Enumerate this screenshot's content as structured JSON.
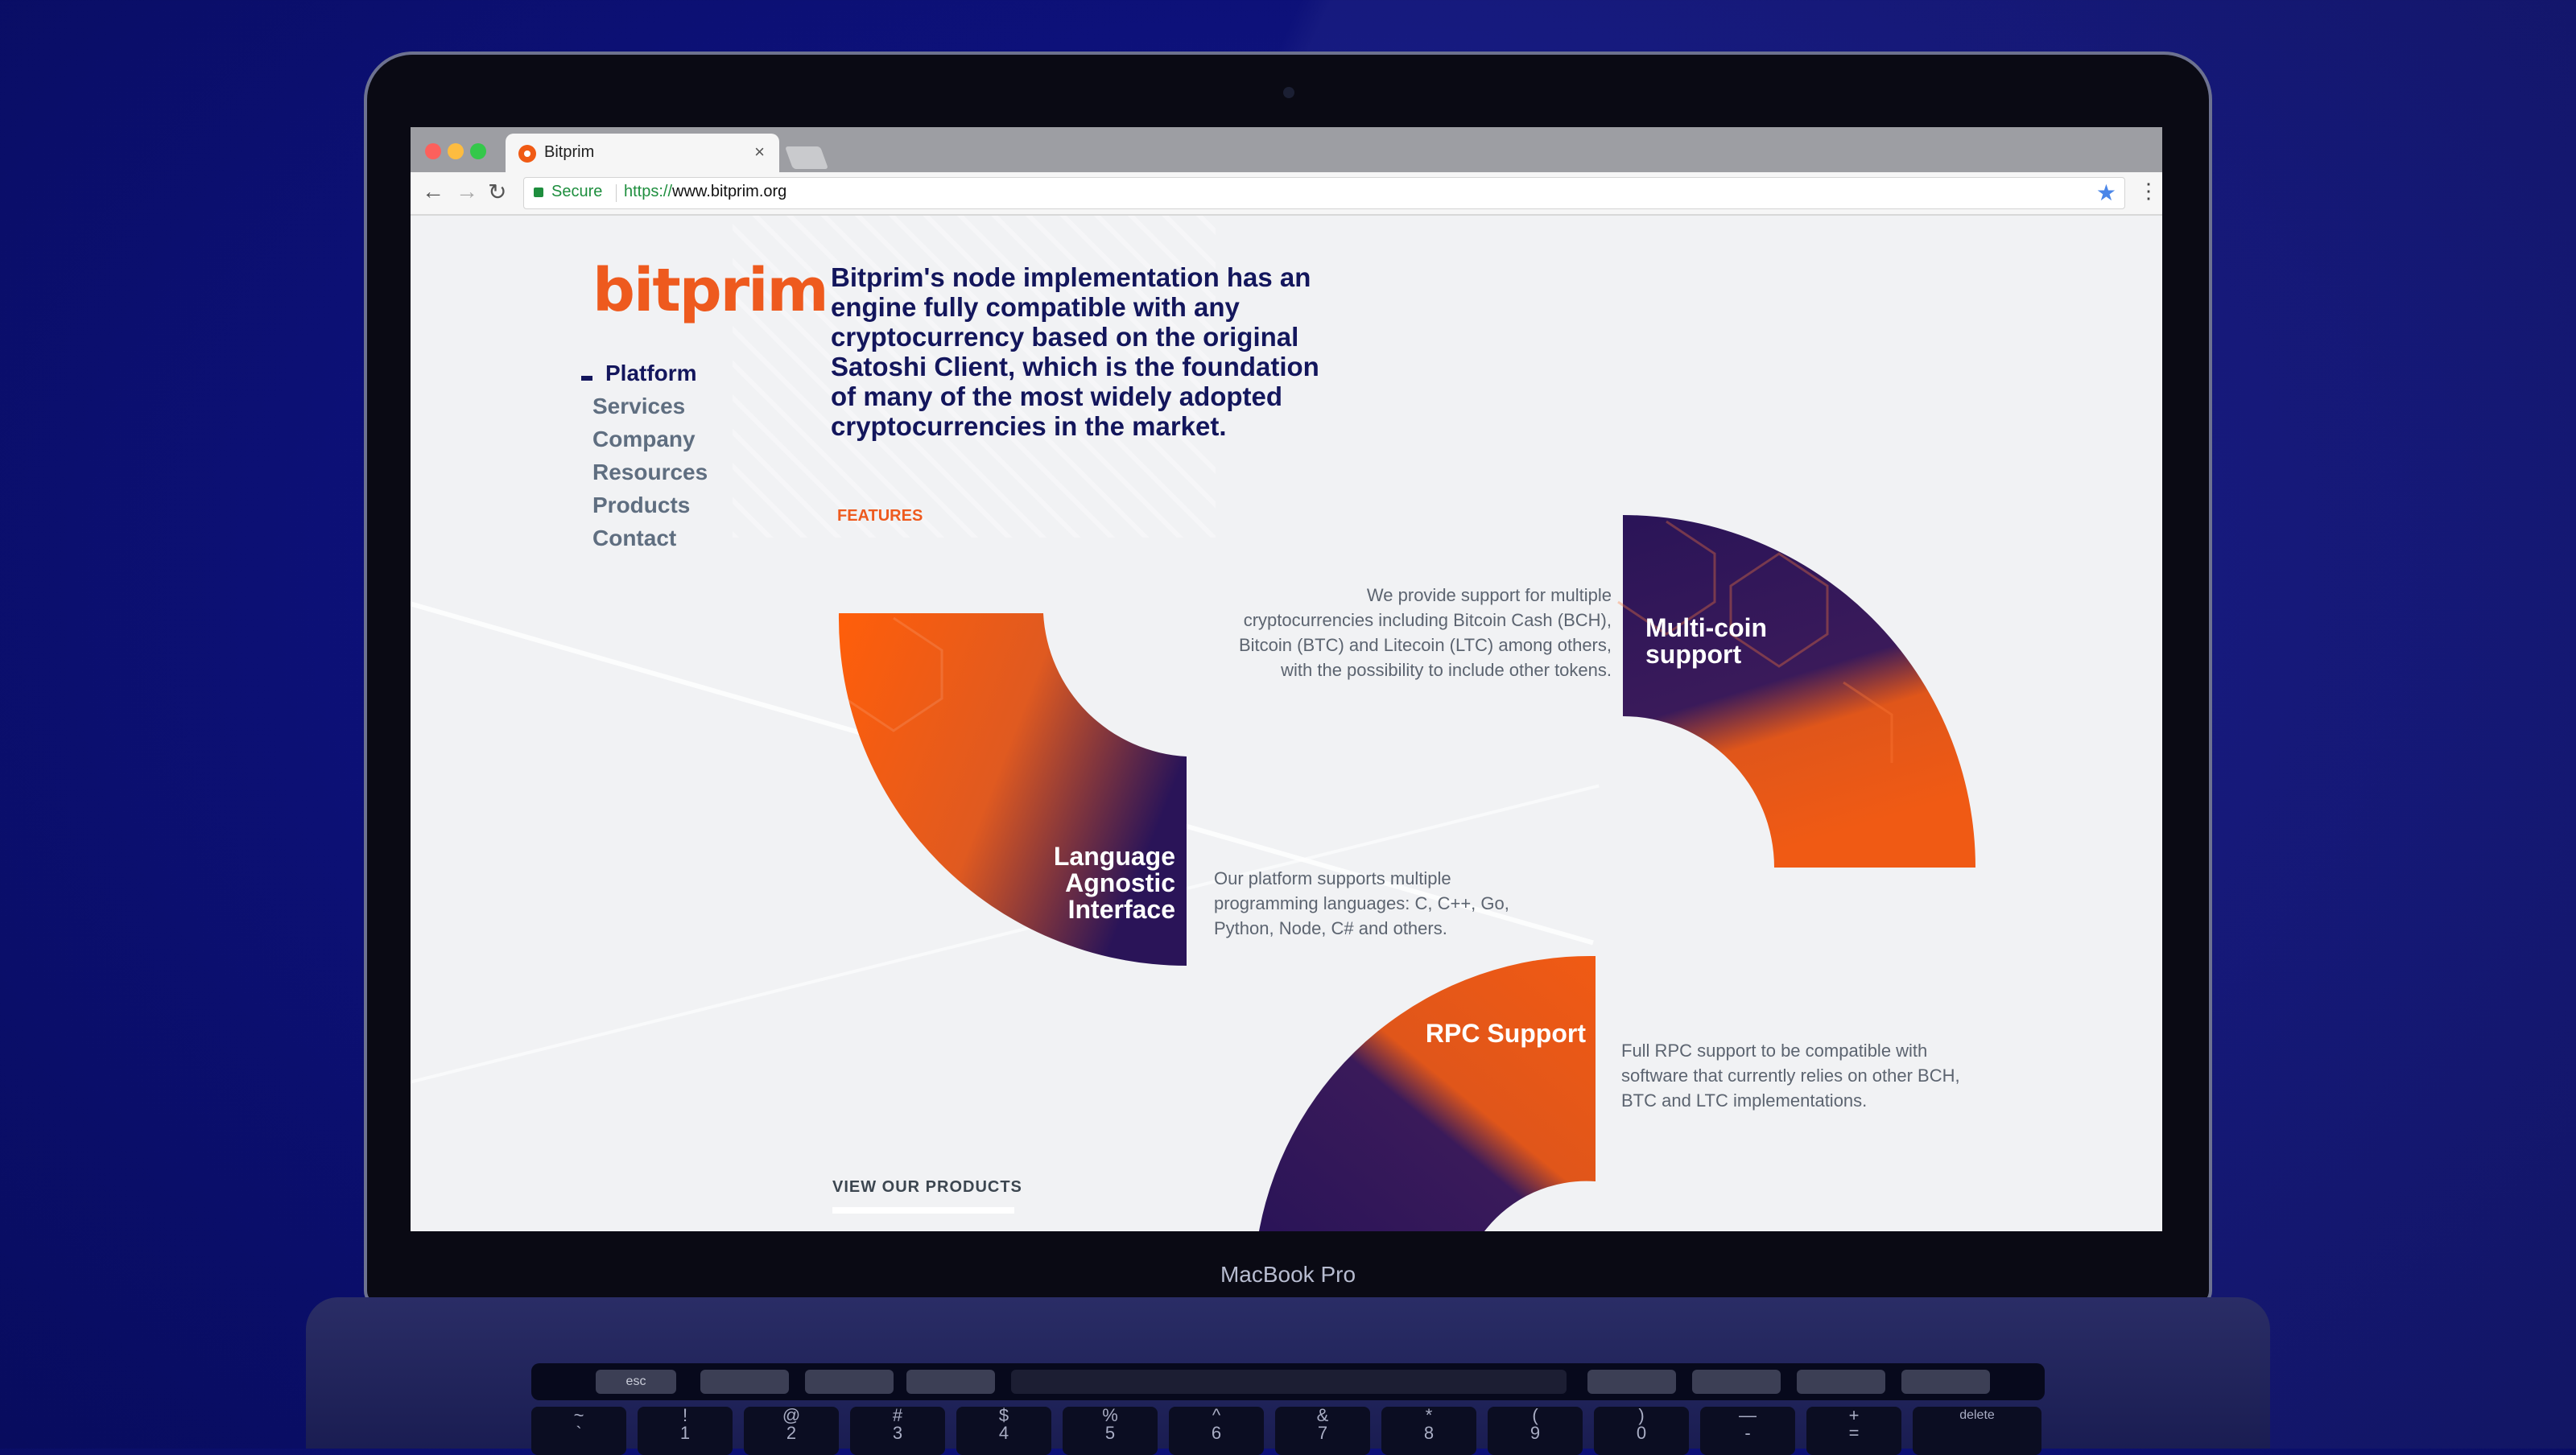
{
  "device": {
    "label": "MacBook Pro"
  },
  "browser": {
    "tab_title": "Bitprim",
    "tab_close": "×",
    "secure_label": "Secure",
    "url_scheme": "https://",
    "url_host": "www.bitprim.org",
    "back_icon": "←",
    "forward_icon": "→",
    "reload_icon": "↻",
    "star_icon": "★",
    "menu_icon": "⋮"
  },
  "page": {
    "logo_text": "bitprim",
    "nav": [
      {
        "label": "Platform",
        "active": true
      },
      {
        "label": "Services"
      },
      {
        "label": "Company"
      },
      {
        "label": "Resources"
      },
      {
        "label": "Products"
      },
      {
        "label": "Contact"
      }
    ],
    "headline": "Bitprim's node implementation has an engine fully compatible with any cryptocurrency based on the original Satoshi Client, which is the foundation of many of the most widely adopted cryptocurrencies in the market.",
    "features_label": "FEATURES",
    "features": [
      {
        "title": "Multi-coin support",
        "description": "We provide support for multiple cryptocurrencies including Bitcoin Cash (BCH), Bitcoin (BTC) and Litecoin (LTC) among others, with the possibility to include other tokens."
      },
      {
        "title": "Language Agnostic Interface",
        "description": "Our platform supports multiple programming languages: C, C++, Go, Python, Node, C# and others."
      },
      {
        "title": "RPC Support",
        "description": "Full RPC support to be compatible with software that currently relies on other BCH, BTC and LTC implementations."
      }
    ],
    "cta_label": "VIEW OUR PRODUCTS"
  },
  "keyboard": {
    "touchbar": [
      "esc"
    ],
    "number_row": [
      {
        "top": "~",
        "bottom": "`"
      },
      {
        "top": "!",
        "bottom": "1"
      },
      {
        "top": "@",
        "bottom": "2"
      },
      {
        "top": "#",
        "bottom": "3"
      },
      {
        "top": "$",
        "bottom": "4"
      },
      {
        "top": "%",
        "bottom": "5"
      },
      {
        "top": "^",
        "bottom": "6"
      },
      {
        "top": "&",
        "bottom": "7"
      },
      {
        "top": "*",
        "bottom": "8"
      },
      {
        "top": "(",
        "bottom": "9"
      },
      {
        "top": ")",
        "bottom": "0"
      },
      {
        "top": "—",
        "bottom": "-"
      },
      {
        "top": "+",
        "bottom": "="
      },
      {
        "top": "",
        "bottom": "delete"
      }
    ]
  },
  "colors": {
    "accent_orange": "#ee5a1e",
    "navy": "#13165c",
    "background": "#0d117a"
  }
}
